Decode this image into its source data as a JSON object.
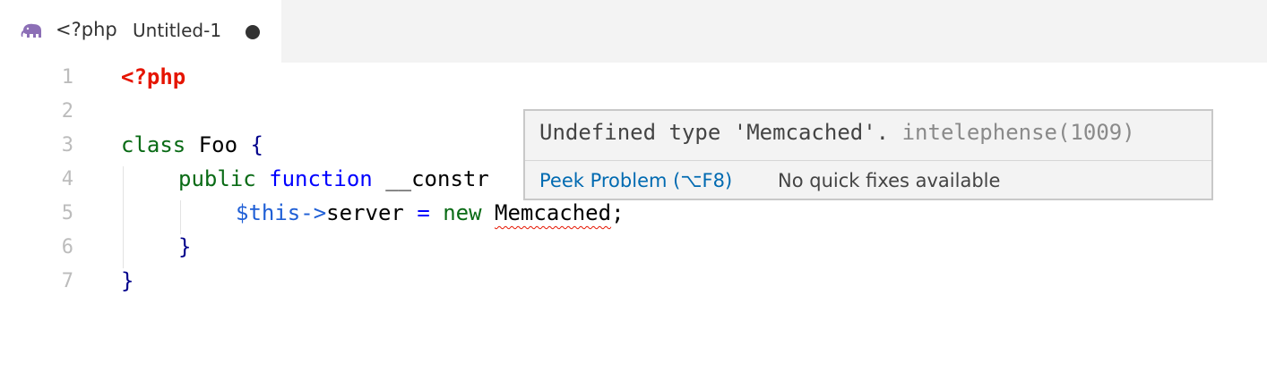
{
  "tab": {
    "icon": "php-elephant-icon",
    "language": "<?php",
    "filename": "Untitled-1"
  },
  "editor": {
    "lines": [
      {
        "number": "1"
      },
      {
        "number": "2"
      },
      {
        "number": "3"
      },
      {
        "number": "4"
      },
      {
        "number": "5"
      },
      {
        "number": "6"
      },
      {
        "number": "7"
      }
    ],
    "tokens": {
      "l1_phptag": "<?php",
      "l3_class": "class",
      "l3_name": " Foo ",
      "l3_brace": "{",
      "l4_public": "public",
      "l4_function": "function",
      "l4_rest": " __constr",
      "l5_this": "$this->",
      "l5_server": "server ",
      "l5_eq": "=",
      "l5_new": " new ",
      "l5_type": "Memcached",
      "l5_semi": ";",
      "l6_brace": "}",
      "l7_brace": "}"
    }
  },
  "hover": {
    "message": "Undefined type 'Memcached'.",
    "source": "intelephense(1009)",
    "peek_label": "Peek Problem (⌥F8)",
    "no_fix_label": "No quick fixes available"
  },
  "colors": {
    "php_tag": "#e51400",
    "keyword_green": "#0a6b16",
    "keyword_blue": "#0000ff",
    "variable": "#1f5fd6",
    "link": "#006ab1",
    "error_squiggle": "#e51400"
  }
}
